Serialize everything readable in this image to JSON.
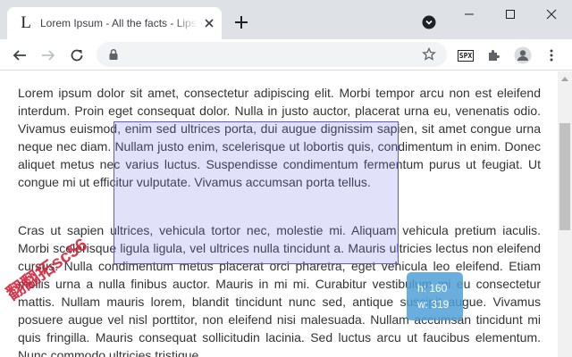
{
  "tab": {
    "favicon_letter": "L",
    "title": "Lorem Ipsum - All the facts - Lipsum"
  },
  "toolbar": {
    "omnibox_value": "",
    "extension_badge": "SPX"
  },
  "content": {
    "paragraph_1": "Lorem ipsum dolor sit amet, consectetur adipiscing elit. Morbi tempor arcu non est eleifend interdum. Proin eget consequat dolor. Nulla in justo auctor, placerat urna eu, venenatis odio. Vivamus euismod, enim sed ultrices porta, dui augue dignissim sapien, sit amet congue urna neque nec diam. Nullam justo enim, scelerisque ut lobortis quis, condimentum in enim. Donec aliquet metus nec varius luctus. Suspendisse condimentum fermentum purus ut feugiat. Ut congue mi ut efficitur vulputate. Vivamus accumsan porta tellus.",
    "paragraph_2": "Cras ut sapien ultrices, vehicula tortor nec, molestie mi. Aliquam vehicula pretium iaculis. Morbi scelerisque ligula ligula, vel ultrices nulla tincidunt a. Mauris ultricies lectus non eleifend cursus. Nulla condimentum metus placerat orci pharetra, eget vehicula leo eleifend. Etiam mollis urna a nulla finibus auctor. Mauris in mi mi. Curabitur vestibulum mi eu consectetur mattis. Nullam mauris lorem, blandit tincidunt nunc sed, antique suscipit augue. Vivamus posuere augue vel nisl porttitor, non eleifend nisi malesuada. Nullam accumsan tincidunt mi quis fringilla. Mauris consequat sollicitudin lacinia. Sed luctus arcu ut faucibus elementum. Nunc commodo ultricies tristique."
  },
  "measurement": {
    "height_label": "h: 160",
    "width_label": "w: 319"
  },
  "watermark": {
    "text": "翻翻拓sc56"
  },
  "colors": {
    "tab_strip": "#dee1e6",
    "selection_fill": "#7878e6",
    "selection_border": "#5b5bd6",
    "badge": "#4fa0d6",
    "watermark": "#d2233a"
  }
}
